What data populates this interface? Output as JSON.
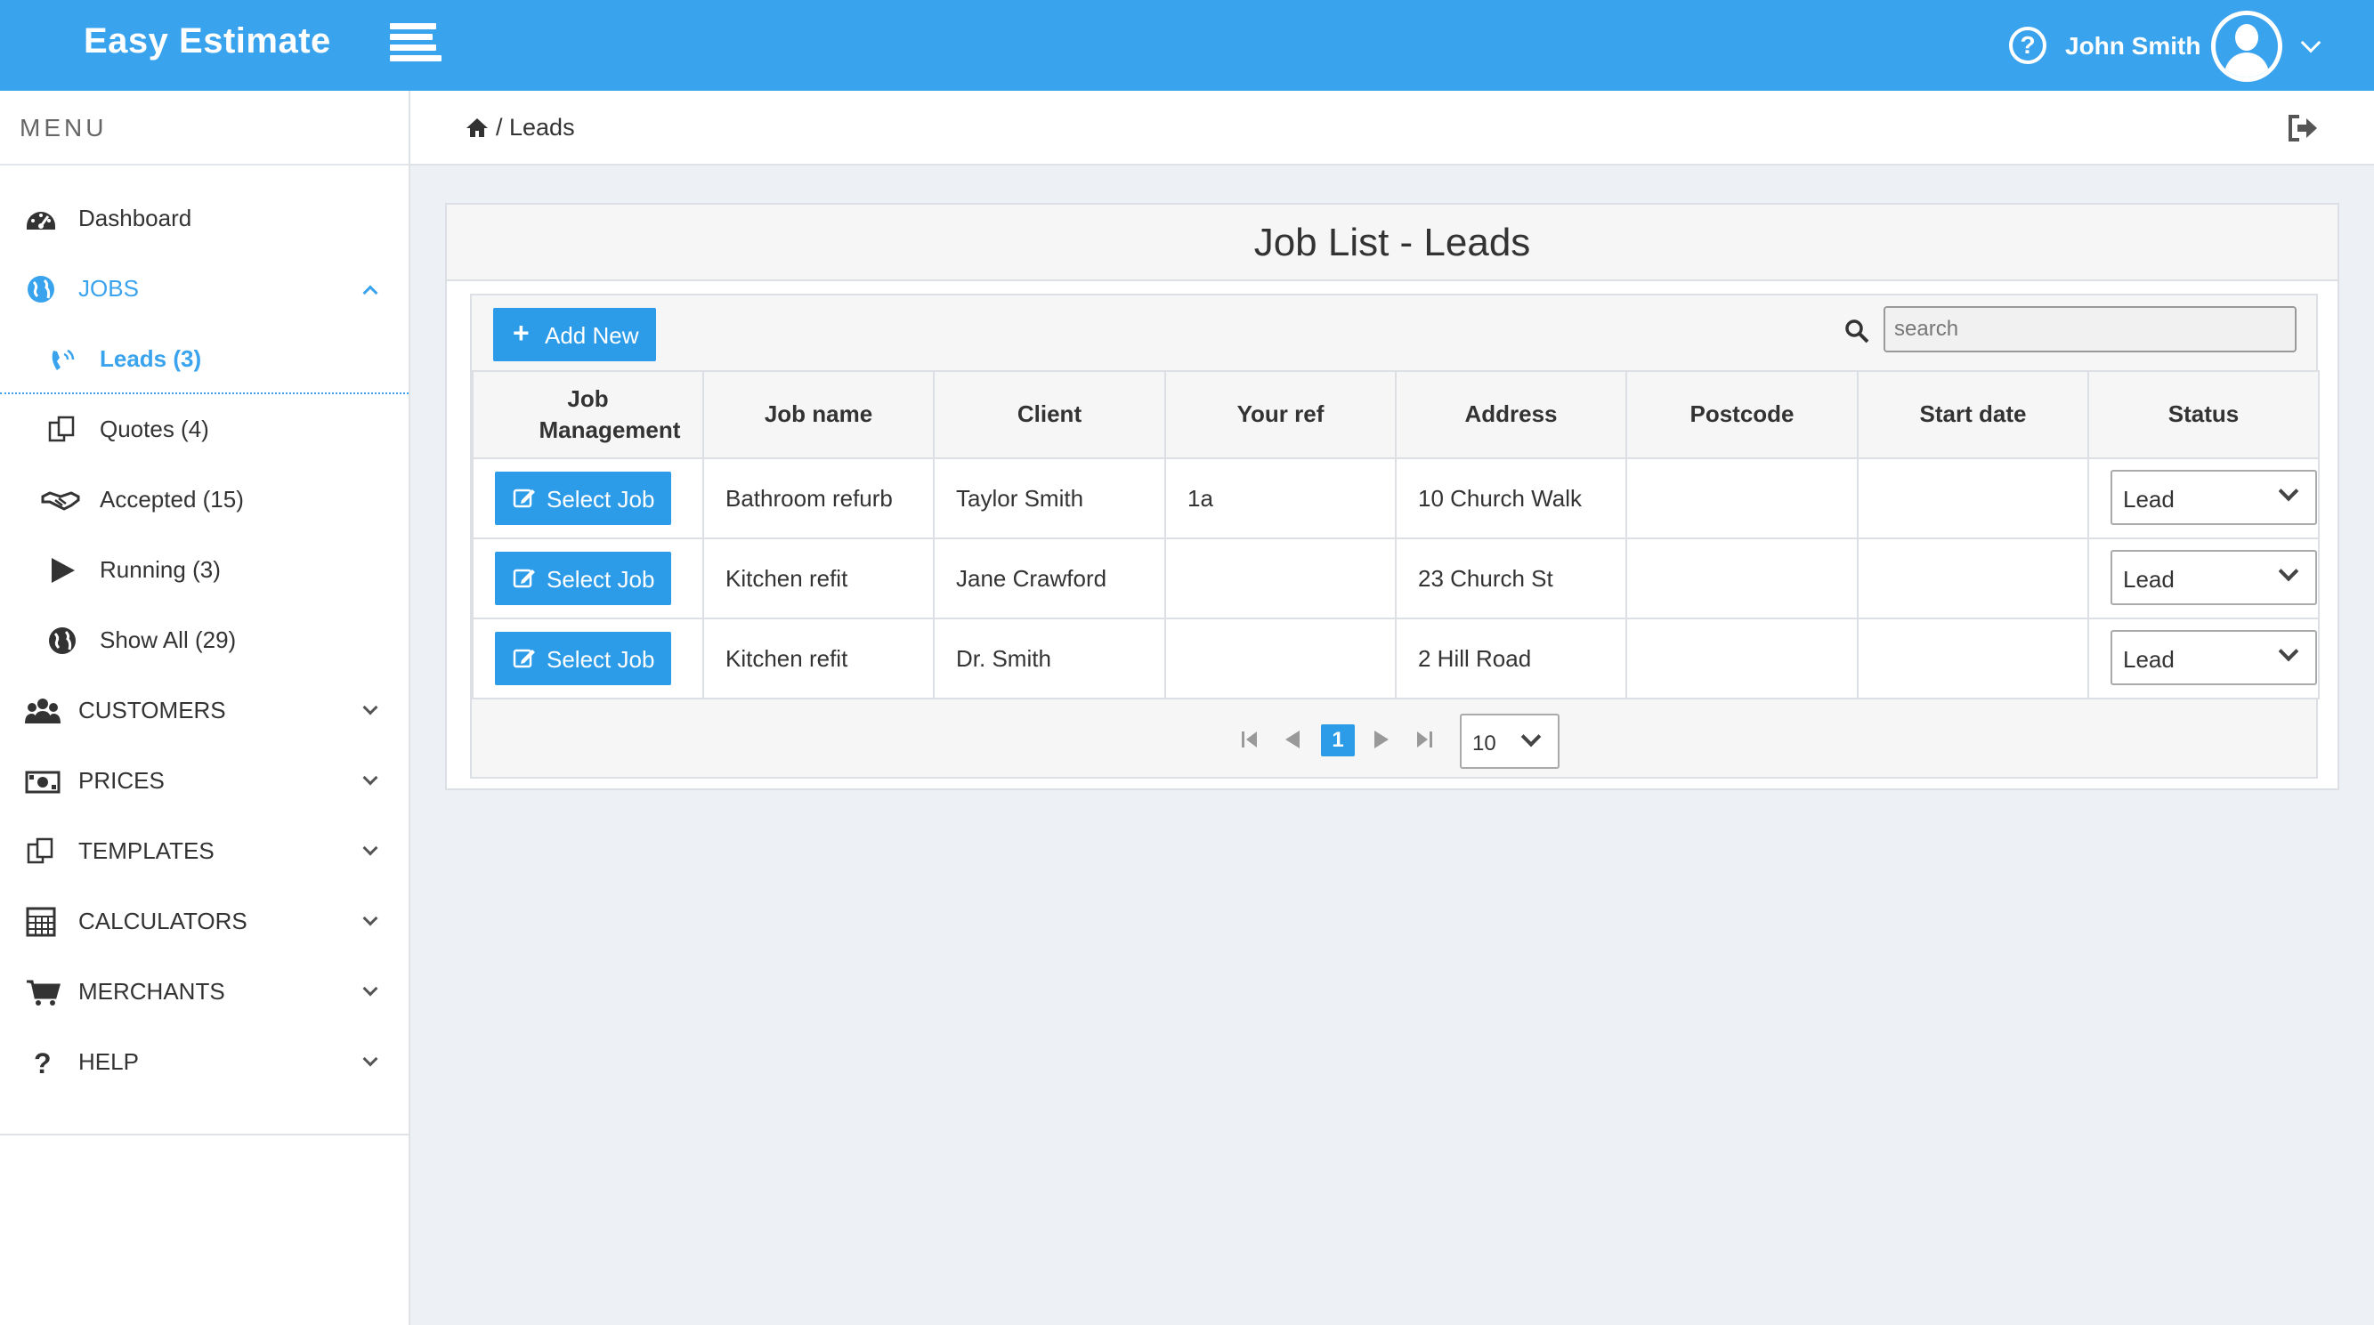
{
  "app": {
    "brand": "Easy Estimate"
  },
  "header": {
    "user_name": "John Smith"
  },
  "sidebar": {
    "menu_title": "MENU",
    "items": [
      {
        "label": "Dashboard",
        "icon": "dashboard-icon"
      },
      {
        "label": "JOBS",
        "icon": "globe-icon"
      },
      {
        "label": "Leads (3)",
        "icon": "phone-ringing-icon"
      },
      {
        "label": "Quotes (4)",
        "icon": "copy-documents-icon"
      },
      {
        "label": "Accepted (15)",
        "icon": "handshake-icon"
      },
      {
        "label": "Running (3)",
        "icon": "play-icon"
      },
      {
        "label": "Show All (29)",
        "icon": "globe-icon"
      },
      {
        "label": "CUSTOMERS",
        "icon": "users-icon"
      },
      {
        "label": "PRICES",
        "icon": "money-icon"
      },
      {
        "label": "TEMPLATES",
        "icon": "copy-documents-icon"
      },
      {
        "label": "CALCULATORS",
        "icon": "calculator-icon"
      },
      {
        "label": "MERCHANTS",
        "icon": "cart-icon"
      },
      {
        "label": "HELP",
        "icon": "question-icon"
      }
    ]
  },
  "breadcrumb": {
    "current": "/ Leads"
  },
  "panel": {
    "title": "Job List - Leads",
    "add_button": "Add New",
    "search_placeholder": "search",
    "columns": [
      "Job Management",
      "Job name",
      "Client",
      "Your ref",
      "Address",
      "Postcode",
      "Start date",
      "Status"
    ],
    "select_label": "Select Job",
    "rows": [
      {
        "job_name": "Bathroom refurb",
        "client": "Taylor Smith",
        "your_ref": "1a",
        "address": "10 Church Walk",
        "postcode": "",
        "start_date": "",
        "status": "Lead"
      },
      {
        "job_name": "Kitchen refit",
        "client": "Jane Crawford",
        "your_ref": "",
        "address": "23 Church St",
        "postcode": "",
        "start_date": "",
        "status": "Lead"
      },
      {
        "job_name": "Kitchen refit",
        "client": "Dr. Smith",
        "your_ref": "",
        "address": "2 Hill Road",
        "postcode": "",
        "start_date": "",
        "status": "Lead"
      }
    ],
    "pager": {
      "current_page": "1",
      "page_size": "10"
    }
  },
  "colors": {
    "accent": "#3aa3ee",
    "button": "#2c9be8"
  }
}
